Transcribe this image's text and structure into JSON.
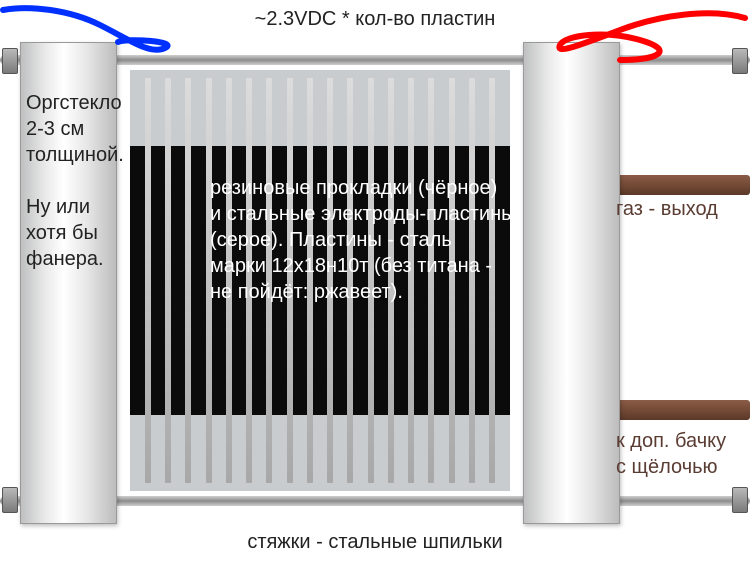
{
  "labels": {
    "top": "~2.3VDC * кол-во пластин",
    "bottom": "стяжки - стальные шпильки",
    "left_line1": "Оргстекло",
    "left_line2": "2-3 см",
    "left_line3": "толщиной.",
    "left_line4": "Ну или",
    "left_line5": "хотя бы",
    "left_line6": "фанера.",
    "center_line1": "резиновые прокладки (чёрное)",
    "center_line2": "и стальные электроды-пластины",
    "center_line3": "(серое). Пластины - сталь",
    "center_line4": "марки 12х18н10т (без титана -",
    "center_line5": "не пойдёт: ржавеет).",
    "pipe_top": "газ - выход",
    "pipe_bottom_line1": "к доп. бачку",
    "pipe_bottom_line2": "с щёлочью"
  },
  "geometry": {
    "plate_count": 18
  },
  "wires": {
    "negative_color": "#0030ff",
    "positive_color": "#ff0000"
  }
}
